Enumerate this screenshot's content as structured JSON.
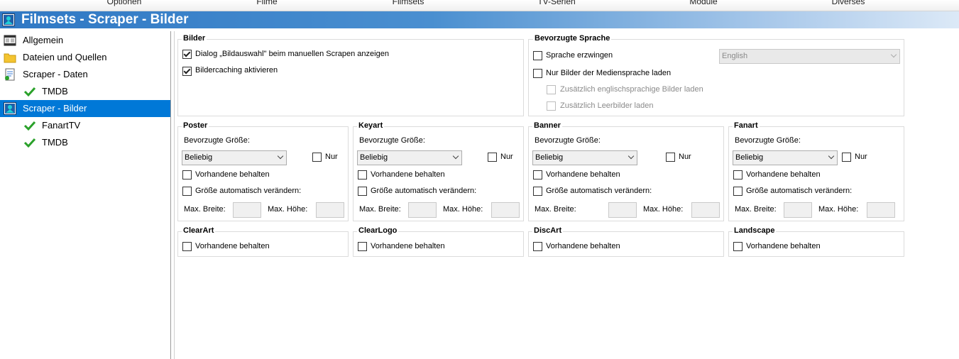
{
  "menu": [
    "Optionen",
    "Filme",
    "Filmsets",
    "TV-Serien",
    "Module",
    "Diverses"
  ],
  "title": "Filmsets - Scraper - Bilder",
  "sidebar": {
    "items": [
      {
        "label": "Allgemein",
        "icon": "filmstrip-icon"
      },
      {
        "label": "Dateien und Quellen",
        "icon": "folder-icon"
      },
      {
        "label": "Scraper - Daten",
        "icon": "document-icon"
      },
      {
        "label": "TMDB",
        "icon": "checkmark-icon"
      },
      {
        "label": "Scraper - Bilder",
        "icon": "image-icon",
        "selected": true
      },
      {
        "label": "FanartTV",
        "icon": "checkmark-icon"
      },
      {
        "label": "TMDB",
        "icon": "checkmark-icon"
      }
    ]
  },
  "bilder": {
    "title": "Bilder",
    "dialog_label": "Dialog „Bildauswahl\" beim manuellen Scrapen anzeigen",
    "dialog_checked": true,
    "caching_label": "Bildercaching aktivieren",
    "caching_checked": true
  },
  "sprache": {
    "title": "Bevorzugte Sprache",
    "force_label": "Sprache erzwingen",
    "language_value": "English",
    "only_media_label": "Nur Bilder der Mediensprache laden",
    "english_label": "Zusätzlich englischsprachige Bilder laden",
    "blank_label": "Zusätzlich Leerbilder laden"
  },
  "types": [
    {
      "title": "Poster",
      "pref_label": "Bevorzugte Größe:",
      "size_value": "Beliebig",
      "only_label": "Nur",
      "keep_label": "Vorhandene behalten",
      "resize_label": "Größe automatisch verändern:",
      "max_width_label": "Max. Breite:",
      "max_height_label": "Max. Höhe:"
    },
    {
      "title": "Keyart",
      "pref_label": "Bevorzugte Größe:",
      "size_value": "Beliebig",
      "only_label": "Nur",
      "keep_label": "Vorhandene behalten",
      "resize_label": "Größe automatisch verändern:",
      "max_width_label": "Max. Breite:",
      "max_height_label": "Max. Höhe:"
    },
    {
      "title": "Banner",
      "pref_label": "Bevorzugte Größe:",
      "size_value": "Beliebig",
      "only_label": "Nur",
      "keep_label": "Vorhandene behalten",
      "resize_label": "Größe automatisch verändern:",
      "max_width_label": "Max. Breite:",
      "max_height_label": "Max. Höhe:"
    },
    {
      "title": "Fanart",
      "pref_label": "Bevorzugte Größe:",
      "size_value": "Beliebig",
      "only_label": "Nur",
      "keep_label": "Vorhandene behalten",
      "resize_label": "Größe automatisch verändern:",
      "max_width_label": "Max. Breite:",
      "max_height_label": "Max. Höhe:"
    }
  ],
  "extras": [
    {
      "title": "ClearArt",
      "keep_label": "Vorhandene behalten"
    },
    {
      "title": "ClearLogo",
      "keep_label": "Vorhandene behalten"
    },
    {
      "title": "DiscArt",
      "keep_label": "Vorhandene behalten"
    },
    {
      "title": "Landscape",
      "keep_label": "Vorhandene behalten"
    }
  ],
  "colors": {
    "accent": "#0078d7",
    "title_bar": "#2f78c4",
    "check_green": "#2aa12a"
  }
}
